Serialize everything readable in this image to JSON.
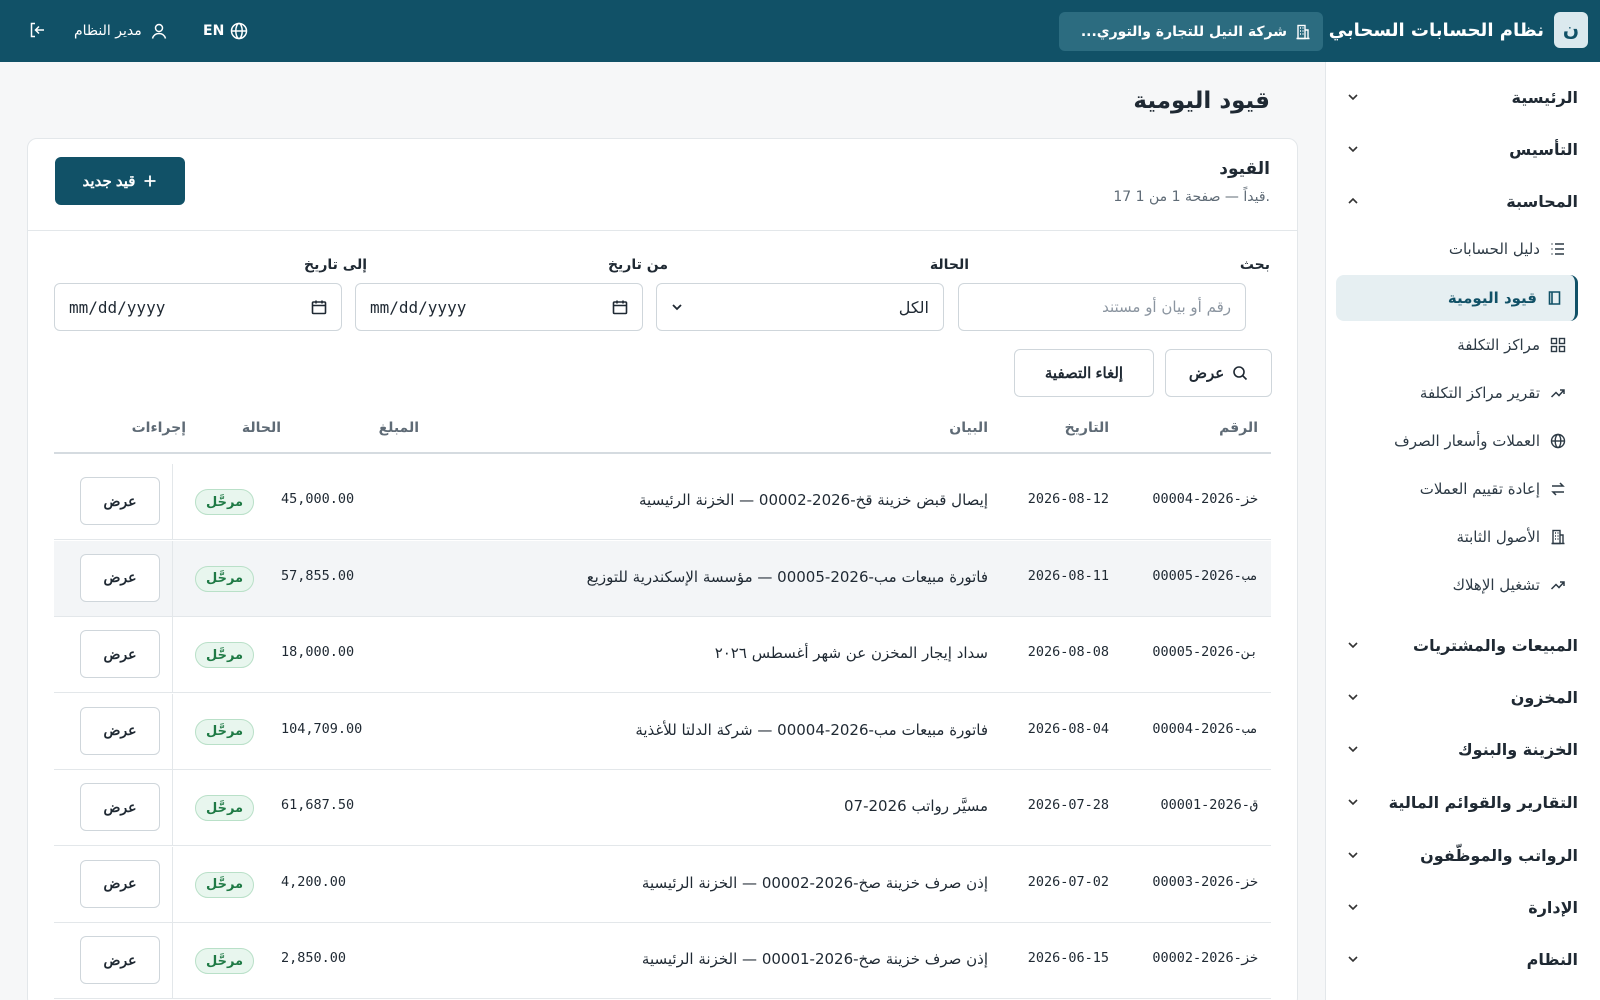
{
  "app": {
    "logo_letter": "ن",
    "title": "نظام الحسابات السحابي",
    "company": "شركة النيل للتجارة والتوري...",
    "language": "EN",
    "user": "مدير النظام"
  },
  "sidebar": {
    "groups_top": [
      {
        "label": "الرئيسية"
      },
      {
        "label": "التأسيس"
      },
      {
        "label": "المحاسبة"
      }
    ],
    "items": [
      {
        "label": "دليل الحسابات",
        "icon": "list-icon"
      },
      {
        "label": "قيود اليومية",
        "icon": "book-icon"
      },
      {
        "label": "مراكز التكلفة",
        "icon": "grid-icon"
      },
      {
        "label": "تقرير مراكز التكلفة",
        "icon": "trend-icon"
      },
      {
        "label": "العملات وأسعار الصرف",
        "icon": "globe-icon"
      },
      {
        "label": "إعادة تقييم العملات",
        "icon": "exchange-icon"
      },
      {
        "label": "الأصول الثابتة",
        "icon": "building-icon"
      },
      {
        "label": "تشغيل الإهلاك",
        "icon": "trend-icon"
      }
    ],
    "groups_bottom": [
      {
        "label": "المبيعات والمشتريات"
      },
      {
        "label": "المخزون"
      },
      {
        "label": "الخزينة والبنوك"
      },
      {
        "label": "التقارير والقوائم المالية"
      },
      {
        "label": "الرواتب والموظّفون"
      },
      {
        "label": "الإدارة"
      },
      {
        "label": "النظام"
      }
    ]
  },
  "page": {
    "title": "قيود اليومية",
    "card_title": "القيود",
    "card_subtitle": "17 قيداً — صفحة 1 من 1.",
    "new_button": "قيد جديد"
  },
  "filters": {
    "search_label": "بحث",
    "search_placeholder": "رقم أو بيان أو مستند",
    "status_label": "الحالة",
    "status_value": "الكل",
    "from_label": "من تاريخ",
    "from_value": "mm/dd/yyyy",
    "to_label": "إلى تاريخ",
    "to_value": "mm/dd/yyyy",
    "apply_button": "عرض",
    "clear_button": "إلغاء التصفية"
  },
  "table": {
    "headers": {
      "number": "الرقم",
      "date": "التاريخ",
      "description": "البيان",
      "amount": "المبلغ",
      "status": "الحالة",
      "actions": "إجراءات"
    },
    "rows": [
      {
        "number": "خز-2026-00004",
        "date": "2026-08-12",
        "description": "إيصال قبض خزينة قخ-2026-00002 — الخزنة الرئيسية",
        "amount": "45,000.00",
        "status": "مرحَّل",
        "action": "عرض"
      },
      {
        "number": "مب-2026-00005",
        "date": "2026-08-11",
        "description": "فاتورة مبيعات مب-2026-00005 — مؤسسة الإسكندرية للتوزيع",
        "amount": "57,855.00",
        "status": "مرحَّل",
        "action": "عرض"
      },
      {
        "number": "بن-2026-00005",
        "date": "2026-08-08",
        "description": "سداد إيجار المخزن عن شهر أغسطس ٢٠٢٦",
        "amount": "18,000.00",
        "status": "مرحَّل",
        "action": "عرض"
      },
      {
        "number": "مب-2026-00004",
        "date": "2026-08-04",
        "description": "فاتورة مبيعات مب-2026-00004 — شركة الدلتا للأغذية",
        "amount": "104,709.00",
        "status": "مرحَّل",
        "action": "عرض"
      },
      {
        "number": "ق-2026-00001",
        "date": "2026-07-28",
        "description": "مسيَّر رواتب 2026-07",
        "amount": "61,687.50",
        "status": "مرحَّل",
        "action": "عرض"
      },
      {
        "number": "خز-2026-00003",
        "date": "2026-07-02",
        "description": "إذن صرف خزينة صخ-2026-00002 — الخزنة الرئيسية",
        "amount": "4,200.00",
        "status": "مرحَّل",
        "action": "عرض"
      },
      {
        "number": "خز-2026-00002",
        "date": "2026-06-15",
        "description": "إذن صرف خزينة صخ-2026-00001 — الخزنة الرئيسية",
        "amount": "2,850.00",
        "status": "مرحَّل",
        "action": "عرض"
      }
    ]
  },
  "colors": {
    "primary": "#115167",
    "status_posted": "#1f7a45",
    "status_posted_bg": "#e8f6ee"
  }
}
